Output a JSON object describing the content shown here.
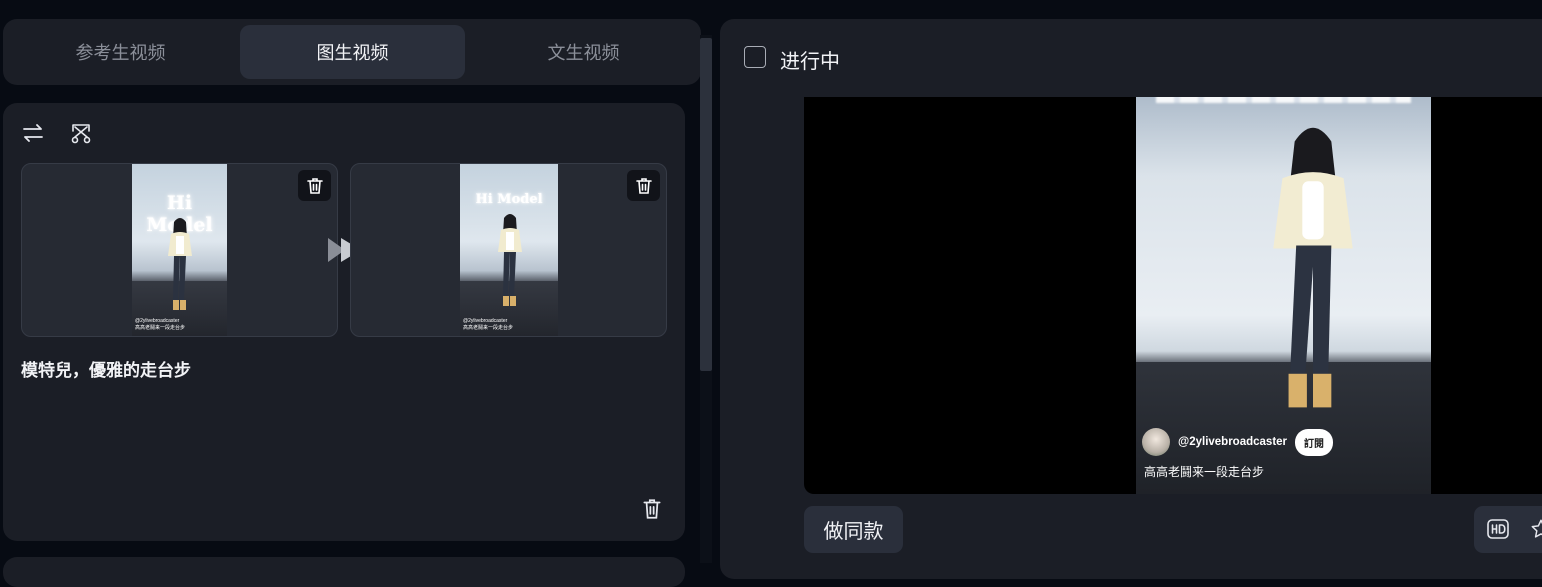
{
  "tabs": [
    {
      "label": "参考生视频",
      "active": false
    },
    {
      "label": "图生视频",
      "active": true
    },
    {
      "label": "文生视频",
      "active": false
    }
  ],
  "left_card": {
    "toolbar_icons": [
      "swap-arrows-icon",
      "remove-cutout-icon"
    ],
    "frames": [
      {
        "name": "start-frame",
        "neon_text": "Hi Model",
        "caption_user": "@2ylivebroadcaster",
        "caption_text": "高高老鬪来一段走台步"
      },
      {
        "name": "end-frame",
        "neon_text": "Hi Model",
        "caption_user": "@2ylivebroadcaster",
        "caption_text": "高高老鬪来一段走台步"
      }
    ],
    "prompt_text": "模特兒，優雅的走台步"
  },
  "right_panel": {
    "status_label": "进行中",
    "checkbox_checked": false,
    "video": {
      "username": "@2ylivebroadcaster",
      "follow_label": "訂閱",
      "caption": "高高老鬪来一段走台步"
    },
    "remake_label": "做同款",
    "action_icons": [
      "hd-icon",
      "star-icon"
    ]
  },
  "colors": {
    "background": "#070b13",
    "panel": "#1b1e26",
    "active_tab": "#2a2f3b",
    "text_primary": "#f2f3f6",
    "text_muted": "#8b8f99"
  }
}
